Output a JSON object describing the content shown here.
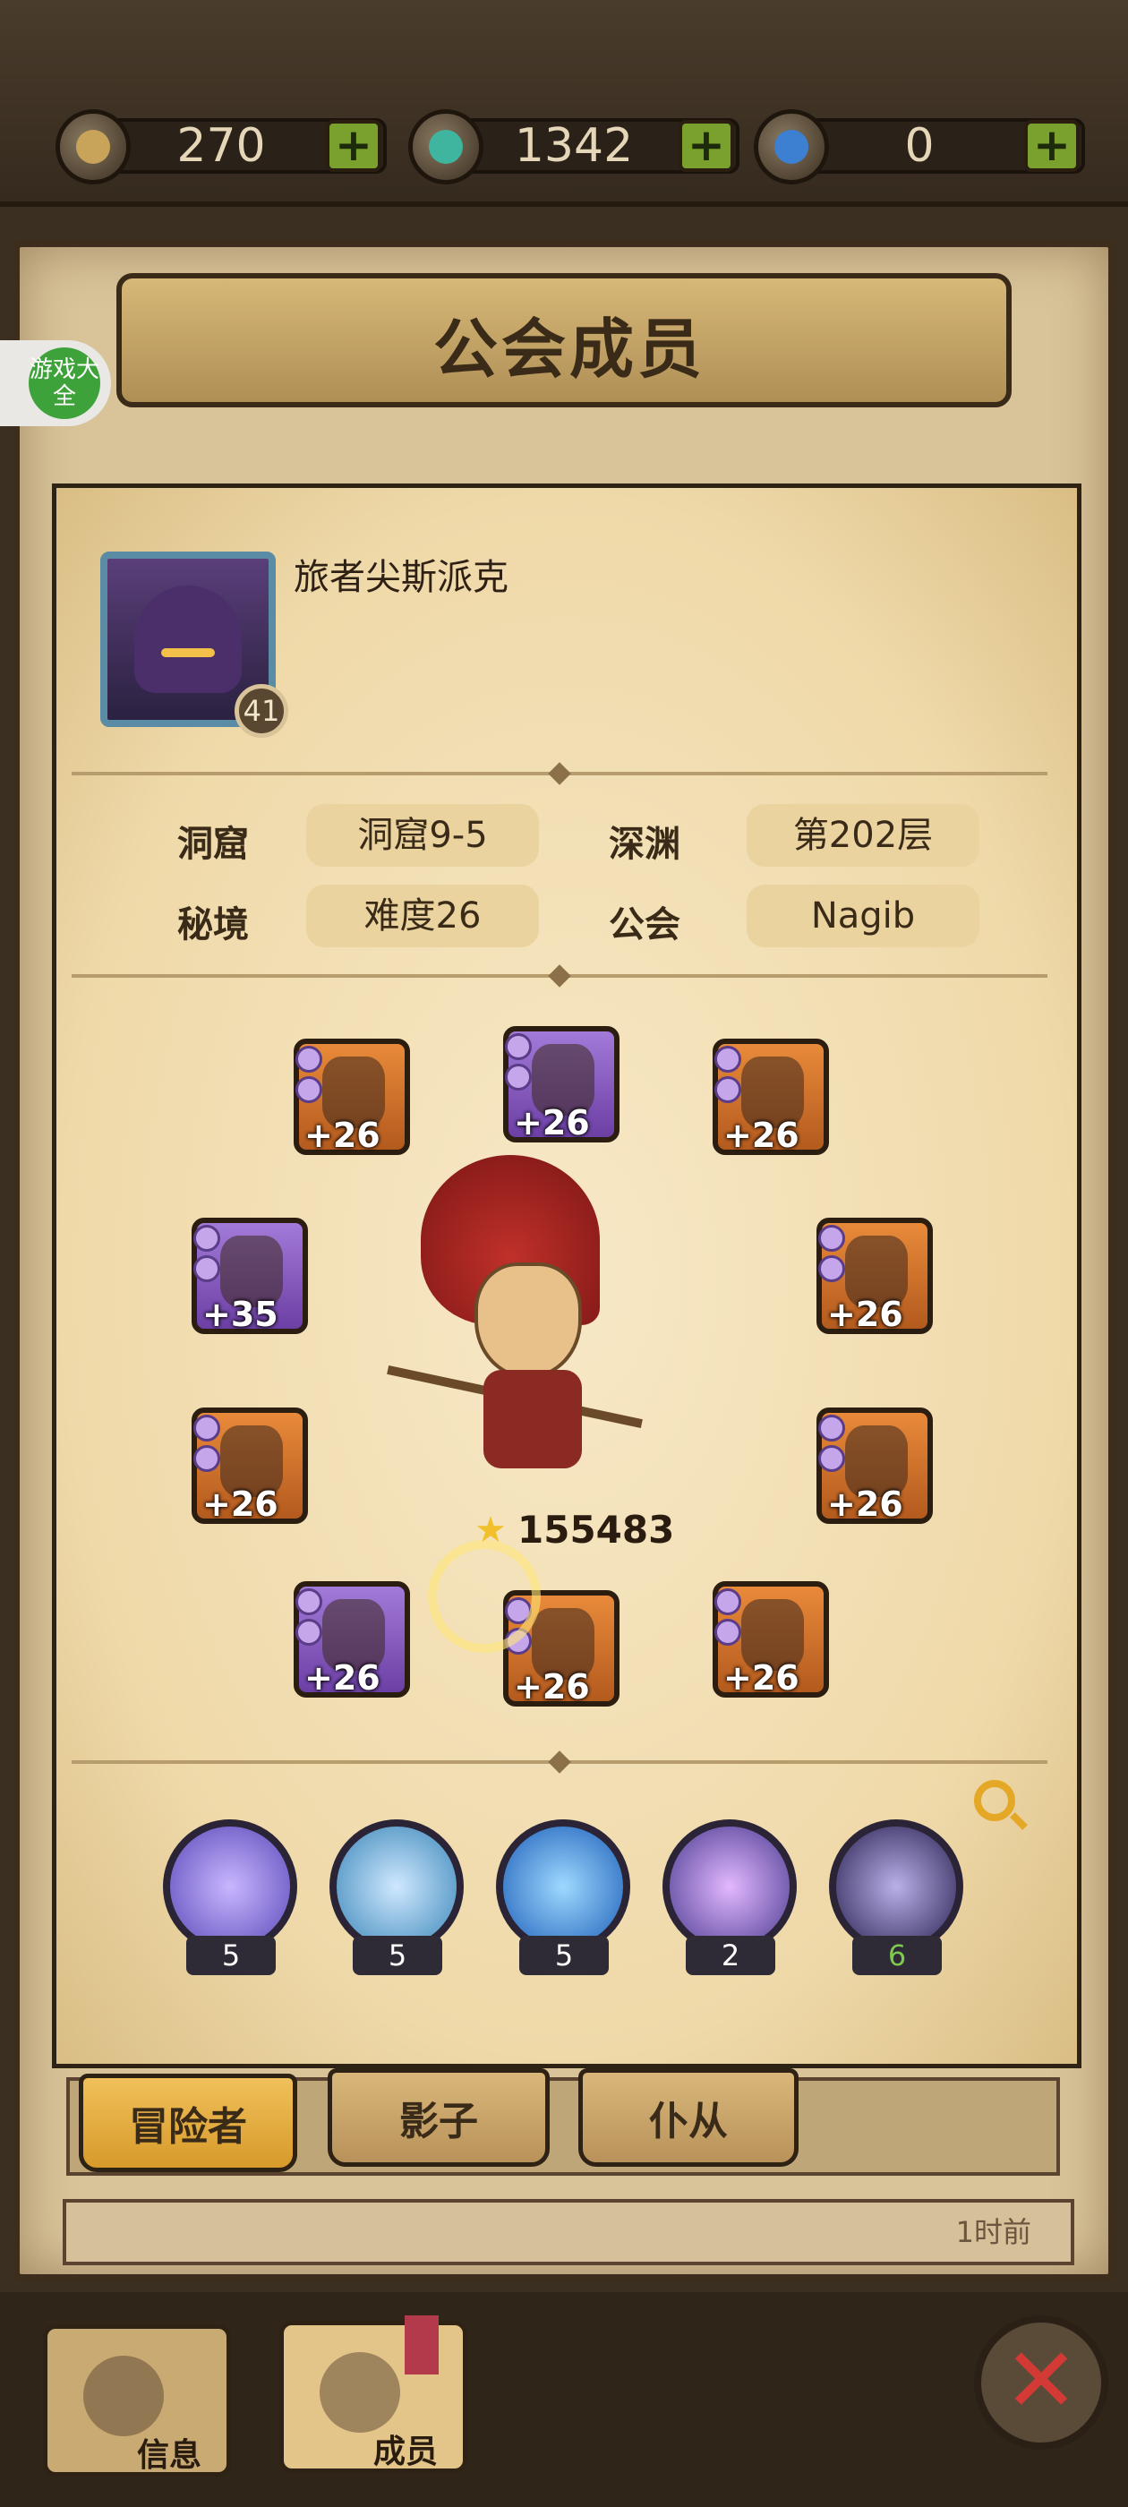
{
  "currencies": [
    {
      "value": "270",
      "plus": "+",
      "icon": "gold-coin-icon",
      "color": "#c8a45a"
    },
    {
      "value": "1342",
      "plus": "+",
      "icon": "green-crystal-icon",
      "color": "#3fb5a0"
    },
    {
      "value": "0",
      "plus": "+",
      "icon": "blue-gem-icon",
      "color": "#3d7fd1"
    }
  ],
  "header": {
    "title": "公会成员"
  },
  "side_badge": {
    "text": "游戏大全"
  },
  "player": {
    "name": "旅者尖斯派克",
    "level": "41"
  },
  "info": {
    "cave_label": "洞窟",
    "cave_value": "洞窟9-5",
    "abyss_label": "深渊",
    "abyss_value": "第202层",
    "secret_label": "秘境",
    "secret_value": "难度26",
    "guild_label": "公会",
    "guild_value": "Nagib"
  },
  "equipment": [
    {
      "level": "+26",
      "rarity": "orange"
    },
    {
      "level": "+26",
      "rarity": "purple"
    },
    {
      "level": "+26",
      "rarity": "orange"
    },
    {
      "level": "+35",
      "rarity": "purple"
    },
    {
      "level": "+26",
      "rarity": "orange"
    },
    {
      "level": "+26",
      "rarity": "orange"
    },
    {
      "level": "+26",
      "rarity": "orange"
    },
    {
      "level": "+26",
      "rarity": "purple"
    },
    {
      "level": "+26",
      "rarity": "orange"
    },
    {
      "level": "+26",
      "rarity": "orange"
    }
  ],
  "power": {
    "value": "155483"
  },
  "skills": [
    {
      "count": "5",
      "color": "#7a6ad8"
    },
    {
      "count": "5",
      "color": "#4fa0c8"
    },
    {
      "count": "5",
      "color": "#2d7ed8"
    },
    {
      "count": "2",
      "color": "#9a6ac8"
    },
    {
      "count": "6",
      "color": "#4a3a78"
    }
  ],
  "skill_count_highlight": "#7ec850",
  "tabs": [
    {
      "label": "冒险者"
    },
    {
      "label": "影子"
    },
    {
      "label": "仆从"
    }
  ],
  "list": {
    "time": "1时前"
  },
  "bottom_nav": [
    {
      "label": "信息"
    },
    {
      "label": "成员"
    }
  ],
  "close": "✕"
}
